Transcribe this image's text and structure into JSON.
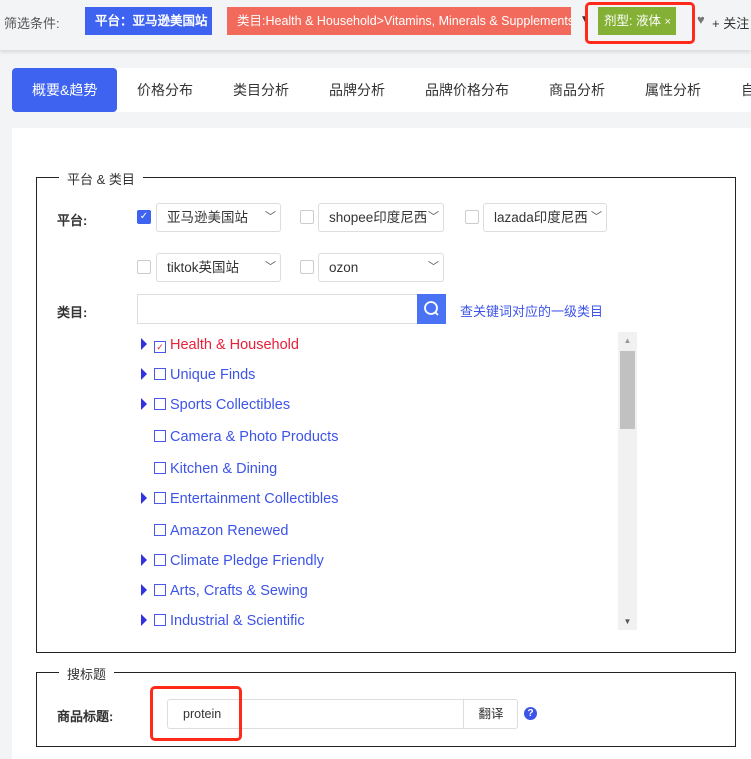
{
  "filter_bar": {
    "label": "筛选条件:",
    "platform_tag": "平台：亚马逊美国站",
    "category_tag": "类目:Health & Household>Vitamins, Minerals & Supplements",
    "dosage_tag": "剂型: 液体",
    "dosage_close": "×",
    "follow": "+ 关注",
    "colors": {
      "platform": "#3d63f0",
      "category": "#f26a5b",
      "dosage": "#84b135",
      "highlight": "#ff2a1a"
    }
  },
  "tabs": [
    "概要&趋势",
    "价格分布",
    "类目分析",
    "品牌分析",
    "品牌价格分布",
    "商品分析",
    "属性分析",
    "自"
  ],
  "platform_section": {
    "legend": "平台 & 类目",
    "platform_label": "平台:",
    "platforms": [
      {
        "name": "亚马逊美国站",
        "checked": true
      },
      {
        "name": "shopee印度尼西",
        "checked": false
      },
      {
        "name": "lazada印度尼西",
        "checked": false
      },
      {
        "name": "tiktok英国站",
        "checked": false
      },
      {
        "name": "ozon",
        "checked": false
      }
    ],
    "category_label": "类目:",
    "category_search_placeholder": "",
    "category_link": "查关键词对应的一级类目",
    "categories": [
      {
        "name": "Health & Household",
        "expandable": true,
        "checked": true
      },
      {
        "name": "Unique Finds",
        "expandable": true,
        "checked": false
      },
      {
        "name": "Sports Collectibles",
        "expandable": true,
        "checked": false
      },
      {
        "name": "Camera & Photo Products",
        "expandable": false,
        "checked": false
      },
      {
        "name": "Kitchen & Dining",
        "expandable": false,
        "checked": false
      },
      {
        "name": "Entertainment Collectibles",
        "expandable": true,
        "checked": false
      },
      {
        "name": "Amazon Renewed",
        "expandable": false,
        "checked": false
      },
      {
        "name": "Climate Pledge Friendly",
        "expandable": true,
        "checked": false
      },
      {
        "name": "Arts, Crafts & Sewing",
        "expandable": true,
        "checked": false
      },
      {
        "name": "Industrial & Scientific",
        "expandable": true,
        "checked": false
      }
    ]
  },
  "title_section": {
    "legend": "搜标题",
    "label": "商品标题:",
    "value": "protein",
    "translate": "翻译",
    "help": "?"
  }
}
